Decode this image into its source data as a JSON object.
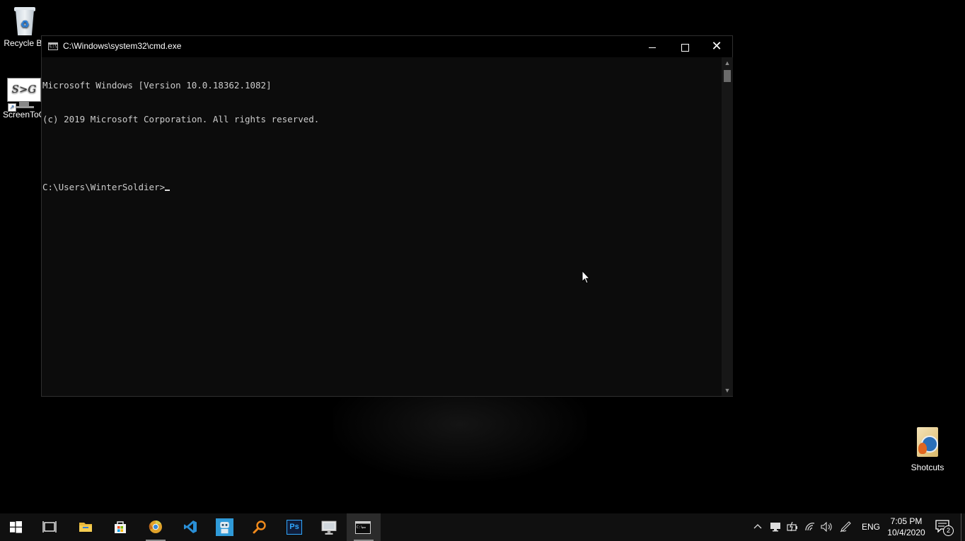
{
  "desktop": {
    "icons": [
      {
        "label": "Recycle Bin"
      },
      {
        "label": "ScreenToGif",
        "art_text": "S>G"
      },
      {
        "label": "Shotcuts"
      }
    ]
  },
  "cmd_window": {
    "title": "C:\\Windows\\system32\\cmd.exe",
    "icon_text": "C:\\",
    "console_lines": [
      "Microsoft Windows [Version 10.0.18362.1082]",
      "(c) 2019 Microsoft Corporation. All rights reserved.",
      "",
      "C:\\Users\\WinterSoldier>"
    ],
    "colors": {
      "background": "#0c0c0c",
      "text": "#cccccc",
      "titlebar": "#000000"
    }
  },
  "taskbar": {
    "apps": [
      {
        "name": "start-button-icon"
      },
      {
        "name": "task-view-icon"
      },
      {
        "name": "file-explorer-icon"
      },
      {
        "name": "microsoft-store-icon"
      },
      {
        "name": "chrome-canary-icon"
      },
      {
        "name": "vscode-icon"
      },
      {
        "name": "robot-app-icon"
      },
      {
        "name": "search-magnifier-app-icon"
      },
      {
        "name": "photoshop-icon",
        "label": "Ps"
      },
      {
        "name": "remote-desktop-icon"
      },
      {
        "name": "command-prompt-icon"
      }
    ],
    "tray": {
      "language": "ENG",
      "time": "7:05 PM",
      "date": "10/4/2020",
      "notification_count": "2"
    }
  }
}
